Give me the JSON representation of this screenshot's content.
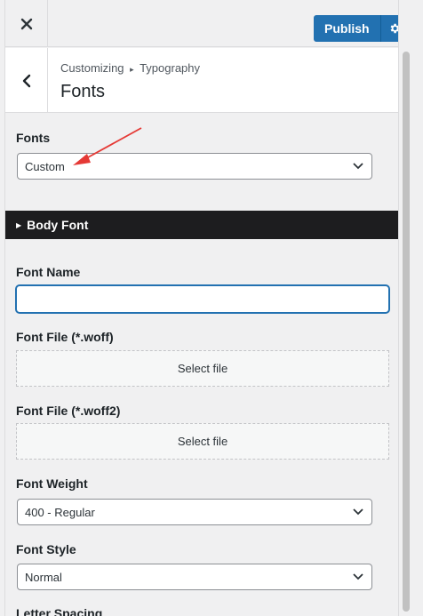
{
  "topbar": {
    "publish_label": "Publish"
  },
  "header": {
    "breadcrumb_parent": "Customizing",
    "breadcrumb_separator": "▸",
    "breadcrumb_section": "Typography",
    "title": "Fonts"
  },
  "fonts": {
    "label": "Fonts",
    "selected": "Custom"
  },
  "body_font": {
    "heading": "Body Font",
    "font_name_label": "Font Name",
    "font_name_value": "",
    "woff_label": "Font File (*.woff)",
    "woff_button": "Select file",
    "woff2_label": "Font File (*.woff2)",
    "woff2_button": "Select file",
    "weight_label": "Font Weight",
    "weight_selected": "400 - Regular",
    "style_label": "Font Style",
    "style_selected": "Normal",
    "letter_spacing_label": "Letter Spacing"
  },
  "colors": {
    "accent": "#2271b1",
    "accordion_bg": "#1d1d1f",
    "annotation_arrow": "#e53935"
  },
  "icons": {
    "close": "close-icon",
    "gear": "gear-icon",
    "back": "chevron-left-icon",
    "dropdown": "chevron-down-icon",
    "expand": "triangle-right-icon"
  }
}
